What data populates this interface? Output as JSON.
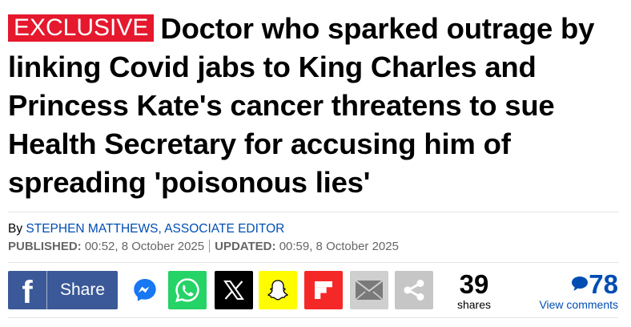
{
  "article": {
    "badge": "EXCLUSIVE",
    "headline": "Doctor who sparked outrage by linking Covid jabs to King Charles and Princess Kate's cancer threatens to sue Health Secretary for accusing him of spreading 'poisonous lies'",
    "byline_prefix": "By",
    "author": "STEPHEN MATTHEWS, ASSOCIATE EDITOR",
    "published_label": "PUBLISHED:",
    "published_value": "00:52, 8 October 2025",
    "updated_label": "UPDATED:",
    "updated_value": "00:59, 8 October 2025"
  },
  "share": {
    "facebook_label": "Share",
    "count": "39",
    "count_label": "shares",
    "buttons": [
      "facebook-icon",
      "messenger-icon",
      "whatsapp-icon",
      "x-icon",
      "snapchat-icon",
      "flipboard-icon",
      "email-icon",
      "share-icon"
    ]
  },
  "comments": {
    "count": "78",
    "label": "View comments"
  },
  "colors": {
    "badge": "#e5182d",
    "link": "#004db3",
    "facebook": "#3b5998",
    "whatsapp": "#25d366",
    "snapchat": "#fffc00",
    "flipboard": "#f52828"
  }
}
